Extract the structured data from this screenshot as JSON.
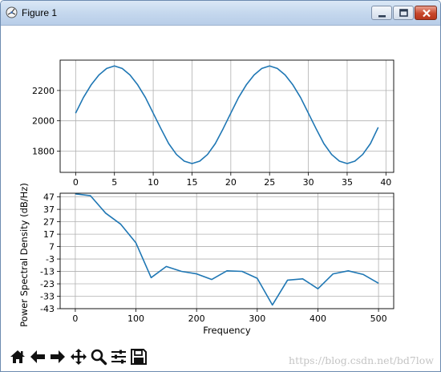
{
  "window": {
    "title": "Figure 1"
  },
  "toolbar": {
    "tools": [
      "home-icon",
      "back-arrow-icon",
      "forward-arrow-icon",
      "pan-icon",
      "zoom-icon",
      "configure-subplots-icon",
      "save-icon"
    ]
  },
  "watermark": "https://blog.csdn.net/bd7low",
  "colors": {
    "line": "#1f77b4",
    "grid": "#b0b0b0"
  },
  "chart_data": [
    {
      "type": "line",
      "title": "",
      "xlabel": "",
      "ylabel": "",
      "xlim": [
        -2,
        41
      ],
      "ylim": [
        1660,
        2400
      ],
      "grid": true,
      "xticks": [
        0,
        5,
        10,
        15,
        20,
        25,
        30,
        35,
        40
      ],
      "yticks": [
        1800,
        2000,
        2200
      ],
      "x": [
        0,
        1,
        2,
        3,
        4,
        5,
        6,
        7,
        8,
        9,
        10,
        11,
        12,
        13,
        14,
        15,
        16,
        17,
        18,
        19,
        20,
        21,
        22,
        23,
        24,
        25,
        26,
        27,
        28,
        29,
        30,
        31,
        32,
        33,
        34,
        35,
        36,
        37,
        38,
        39
      ],
      "y": [
        2050,
        2153,
        2237,
        2302,
        2345,
        2362,
        2345,
        2302,
        2237,
        2153,
        2050,
        1947,
        1850,
        1778,
        1734,
        1718,
        1734,
        1778,
        1850,
        1947,
        2050,
        2153,
        2237,
        2302,
        2345,
        2362,
        2345,
        2302,
        2237,
        2153,
        2050,
        1947,
        1850,
        1778,
        1734,
        1718,
        1734,
        1778,
        1850,
        1957
      ]
    },
    {
      "type": "line",
      "title": "",
      "xlabel": "Frequency",
      "ylabel": "Power Spectral Density (dB/Hz)",
      "xlim": [
        -25,
        525
      ],
      "ylim": [
        -43,
        50
      ],
      "grid": true,
      "xticks": [
        0,
        100,
        200,
        300,
        400,
        500
      ],
      "yticks": [
        -43,
        -33,
        -23,
        -13,
        -3,
        7,
        17,
        27,
        37,
        47
      ],
      "x": [
        0,
        25,
        50,
        75,
        100,
        125,
        150,
        175,
        200,
        225,
        250,
        275,
        300,
        325,
        350,
        375,
        400,
        425,
        450,
        475,
        500
      ],
      "y": [
        49.5,
        48,
        34,
        25,
        10,
        -18,
        -9,
        -13,
        -15,
        -19.5,
        -12.5,
        -13,
        -18.5,
        -40,
        -20,
        -19,
        -27,
        -15,
        -12.5,
        -15.5,
        -22.5
      ]
    }
  ]
}
